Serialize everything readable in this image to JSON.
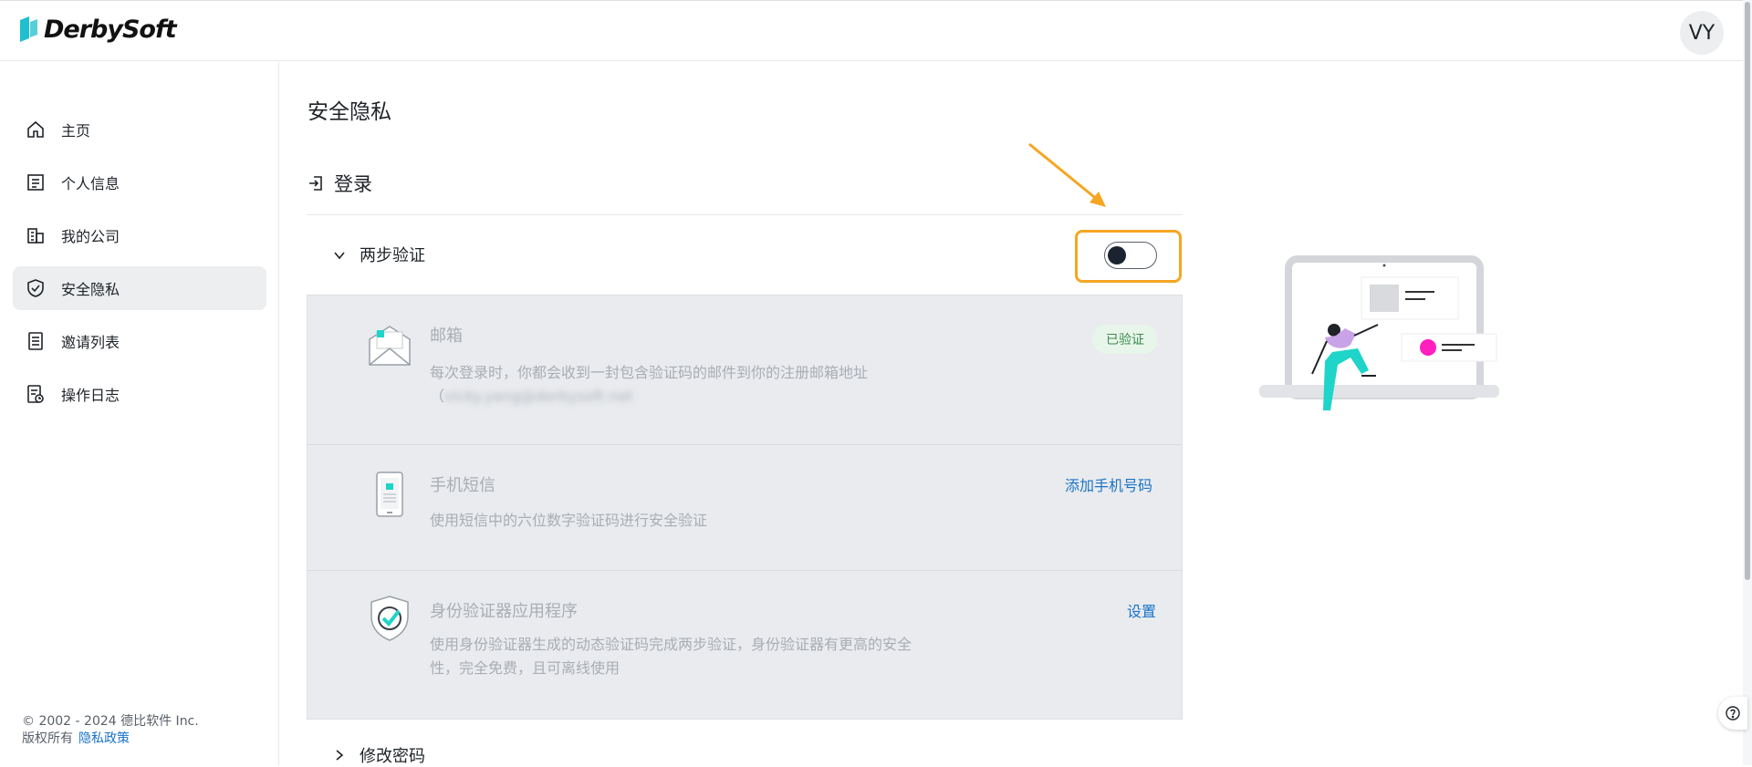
{
  "brand": {
    "name": "DerbySoft",
    "accent": "#1fbfcf"
  },
  "user": {
    "initials": "VY"
  },
  "sidebar": {
    "items": [
      {
        "label": "主页",
        "icon": "home-icon"
      },
      {
        "label": "个人信息",
        "icon": "id-card-icon"
      },
      {
        "label": "我的公司",
        "icon": "building-icon"
      },
      {
        "label": "安全隐私",
        "icon": "shield-icon",
        "active": true
      },
      {
        "label": "邀请列表",
        "icon": "list-icon"
      },
      {
        "label": "操作日志",
        "icon": "log-icon"
      }
    ],
    "footer": {
      "copyright": "© 2002 - 2024 德比软件 Inc.",
      "rights": "版权所有",
      "privacy_link": "隐私政策"
    }
  },
  "page": {
    "title": "安全隐私",
    "section": "登录",
    "two_factor": {
      "label": "两步验证",
      "enabled": false
    },
    "methods": {
      "email": {
        "title": "邮箱",
        "desc": "每次登录时，你都会收到一封包含验证码的邮件到你的注册邮箱地址",
        "address_prefix": "（",
        "address": "vicky.yang@derbysoft.net",
        "badge": "已验证"
      },
      "sms": {
        "title": "手机短信",
        "desc": "使用短信中的六位数字验证码进行安全验证",
        "action": "添加手机号码"
      },
      "authenticator": {
        "title": "身份验证器应用程序",
        "desc": "使用身份验证器生成的动态验证码完成两步验证，身份验证器有更高的安全性，完全免费，且可离线使用",
        "action": "设置"
      }
    },
    "change_password": "修改密码"
  },
  "colors": {
    "highlight": "#f5a623",
    "link": "#1a73c8",
    "verified_bg": "#e8f5ea",
    "verified_text": "#3d8b4d",
    "illustration_accent": "#ff1fbf"
  }
}
